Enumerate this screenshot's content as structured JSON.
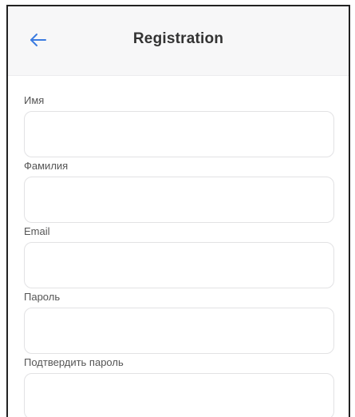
{
  "header": {
    "title": "Registration"
  },
  "colors": {
    "accent": "#3b7be0",
    "header_bg": "#f7f7f8",
    "field_border": "#e2e2e4"
  },
  "form": {
    "fields": [
      {
        "label": "Имя",
        "value": ""
      },
      {
        "label": "Фамилия",
        "value": ""
      },
      {
        "label": "Email",
        "value": ""
      },
      {
        "label": "Пароль",
        "value": ""
      },
      {
        "label": "Подтвердить пароль",
        "value": ""
      }
    ]
  }
}
